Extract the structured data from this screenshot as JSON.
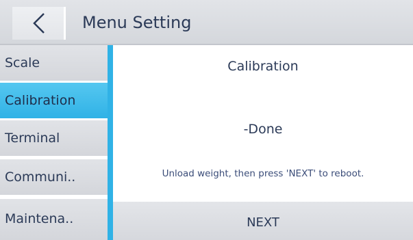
{
  "header": {
    "back_icon": "chevron-left-icon",
    "title": "Menu Setting"
  },
  "sidebar": {
    "items": [
      {
        "label": "Scale",
        "active": false
      },
      {
        "label": "Calibration",
        "active": true
      },
      {
        "label": "Terminal",
        "active": false
      },
      {
        "label": "Communi..",
        "active": false
      },
      {
        "label": "Maintena..",
        "active": false
      }
    ]
  },
  "content": {
    "title": "Calibration",
    "status": "-Done",
    "instruction": "Unload weight, then press 'NEXT' to reboot.",
    "next_label": "NEXT"
  },
  "colors": {
    "accent": "#30b2e6",
    "text": "#2b3a57",
    "header_bg": "#d9dce1"
  }
}
